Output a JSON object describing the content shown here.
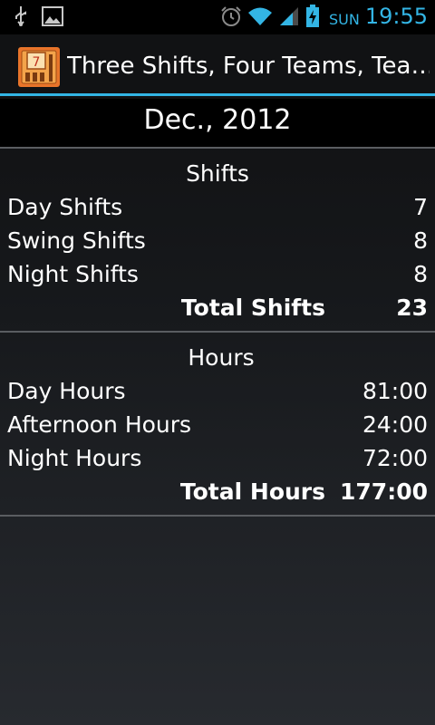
{
  "status_bar": {
    "day": "SUN",
    "time": "19:55",
    "icons": [
      "usb-icon",
      "image-icon",
      "alarm-icon",
      "wifi-icon",
      "signal-icon",
      "battery-charging-icon"
    ]
  },
  "action_bar": {
    "title": "Three Shifts, Four Teams, Tea…",
    "icon_text": "7"
  },
  "month": "Dec., 2012",
  "shifts": {
    "title": "Shifts",
    "rows": [
      {
        "label": "Day Shifts",
        "value": "7"
      },
      {
        "label": "Swing Shifts",
        "value": "8"
      },
      {
        "label": "Night Shifts",
        "value": "8"
      }
    ],
    "total_label": "Total Shifts",
    "total_value": "23"
  },
  "hours": {
    "title": "Hours",
    "rows": [
      {
        "label": "Day Hours",
        "value": "81:00"
      },
      {
        "label": "Afternoon Hours",
        "value": "24:00"
      },
      {
        "label": "Night Hours",
        "value": "72:00"
      }
    ],
    "total_label": "Total Hours",
    "total_value": "177:00"
  },
  "colors": {
    "accent": "#33b5e5",
    "app_icon": "#e8742a"
  }
}
